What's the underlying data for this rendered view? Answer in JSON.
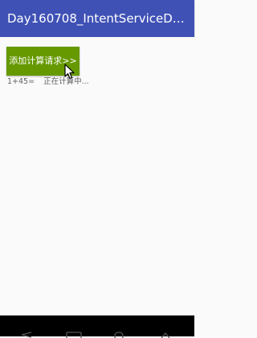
{
  "app_bar": {
    "title": "Day160708_IntentServiceDe..."
  },
  "main": {
    "add_button_label": "添加计算请求>>",
    "results": [
      {
        "expression": "1+45=",
        "status": "正在计算中..."
      }
    ]
  },
  "nav_bar": {
    "icons": [
      "back-icon",
      "home-icon",
      "recents-icon"
    ]
  },
  "colors": {
    "app_bar": "#3f51b5",
    "button": "#669900",
    "background": "#fafafa",
    "nav_bar": "#000000"
  }
}
